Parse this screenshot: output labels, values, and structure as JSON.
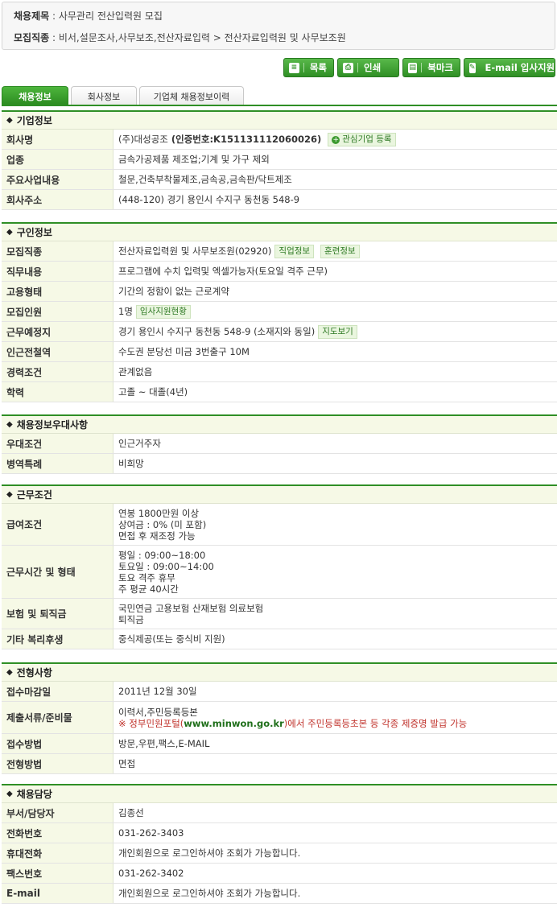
{
  "header": {
    "title_label": "채용제목",
    "title_value": "사무관리 전산입력원 모집",
    "category_label": "모집직종",
    "category_value": "비서,설문조사,사무보조,전산자료입력 > 전산자료입력원 및 사무보조원"
  },
  "buttons": [
    {
      "label": "목록",
      "icon": "list-icon"
    },
    {
      "label": "인쇄",
      "icon": "print-icon"
    },
    {
      "label": "북마크",
      "icon": "bookmark-icon"
    },
    {
      "label": "E-mail 입사지원",
      "icon": "pencil-icon"
    }
  ],
  "tabs": [
    "채용정보",
    "회사정보",
    "기업체 채용정보이력"
  ],
  "company": {
    "heading": "기업정보",
    "name_label": "회사명",
    "name_value": "(주)대성공조",
    "cert_text": "(인증번호:K151131112060026)",
    "fav_button": "관심기업 등록",
    "industry_label": "업종",
    "industry_value": "금속가공제품 제조업;기계 및 가구 제외",
    "business_label": "주요사업내용",
    "business_value": "철문,건축부착물제조,금속공,금속판/닥트제조",
    "address_label": "회사주소",
    "address_value": "(448-120) 경기 용인시 수지구 동천동 548-9"
  },
  "recruit": {
    "heading": "구인정보",
    "job_label": "모집직종",
    "job_value": "전산자료입력원 및 사무보조원(02920)",
    "job_info_button": "직업정보",
    "training_button": "훈련정보",
    "duty_label": "직무내용",
    "duty_value": "프로그램에 수치 입력및 엑셀가능자(토요일 격주 근무)",
    "employment_label": "고용형태",
    "employment_value": "기간의 정함이 없는 근로계약",
    "count_label": "모집인원",
    "count_value": "1명",
    "apply_status_button": "입사지원현황",
    "location_label": "근무예정지",
    "location_value": "경기 용인시 수지구 동천동 548-9 (소재지와 동일)",
    "map_button": "지도보기",
    "subway_label": "인근전철역",
    "subway_value": "수도권 분당선 미금 3번출구 10M",
    "career_label": "경력조건",
    "career_value": "관계없음",
    "education_label": "학력",
    "education_value": "고졸 ~ 대졸(4년)"
  },
  "preference": {
    "heading": "채용정보우대사항",
    "pref_label": "우대조건",
    "pref_value": "인근거주자",
    "military_label": "병역특례",
    "military_value": "비희망"
  },
  "conditions": {
    "heading": "근무조건",
    "salary_label": "급여조건",
    "salary_lines": [
      "연봉 1800만원 이상",
      "상여금 : 0% (미 포함)",
      "면접 후 재조정 가능"
    ],
    "hours_label": "근무시간 및 형태",
    "hours_lines": [
      "평일 : 09:00~18:00",
      "토요일 : 09:00~14:00",
      "토요 격주 휴무",
      "주 평균 40시간"
    ],
    "insurance_label": "보험 및 퇴직금",
    "insurance_lines": [
      "국민연금 고용보험 산재보험 의료보험",
      "퇴직금"
    ],
    "welfare_label": "기타 복리후생",
    "welfare_value": "중식제공(또는 중식비 지원)"
  },
  "selection": {
    "heading": "전형사항",
    "deadline_label": "접수마감일",
    "deadline_value": "2011년 12월 30일",
    "docs_label": "제출서류/준비물",
    "docs_value": "이력서,주민등록등본",
    "docs_note_prefix": "※ 정부민원포털(",
    "docs_note_link": "www.minwon.go.kr",
    "docs_note_suffix": ")에서 주민등록등초본 등 각종 제증명 발급 가능",
    "method_label": "접수방법",
    "method_value": "방문,우편,팩스,E-MAIL",
    "process_label": "전형방법",
    "process_value": "면접"
  },
  "contact": {
    "heading": "채용담당",
    "person_label": "부서/담당자",
    "person_value": "김종선",
    "phone_label": "전화번호",
    "phone_value": "031-262-3403",
    "mobile_label": "휴대전화",
    "mobile_value": "개인회원으로 로그인하셔야 조회가 가능합니다.",
    "fax_label": "팩스번호",
    "fax_value": "031-262-3402",
    "email_label": "E-mail",
    "email_value": "개인회원으로 로그인하셔야 조회가 가능합니다."
  },
  "colors": {
    "accent_green": "#2f8f25",
    "label_bg": "#f6f9e6",
    "notice_red": "#c0322b"
  }
}
